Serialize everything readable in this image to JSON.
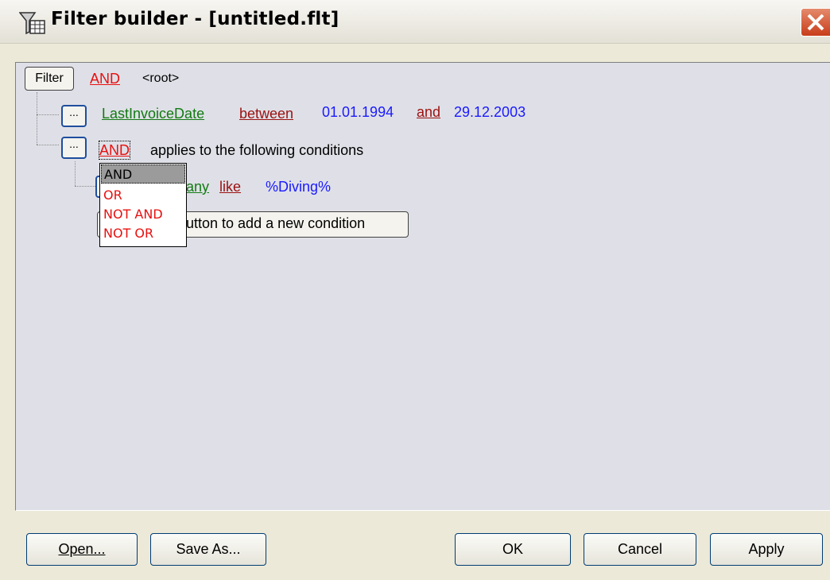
{
  "window": {
    "title": "Filter builder - [untitled.flt]"
  },
  "tree": {
    "root_button_label": "Filter",
    "root_operator": "AND",
    "root_label": "<root>",
    "condition1": {
      "button_label": "...",
      "field": "LastInvoiceDate",
      "operator": "between",
      "value1": "01.01.1994",
      "conjunction": "and",
      "value2": "29.12.2003"
    },
    "group": {
      "button_label": "...",
      "operator": "AND",
      "description": "applies to the following conditions",
      "condition": {
        "field_visible": "any",
        "operator": "like",
        "value": "%Diving%"
      },
      "add_hint_visible": "utton to add a new condition"
    }
  },
  "operator_dropdown": {
    "options": [
      "AND",
      "OR",
      "NOT AND",
      "NOT OR"
    ],
    "selected": "AND"
  },
  "buttons": {
    "open": "Open...",
    "save_as": "Save As...",
    "ok": "OK",
    "cancel": "Cancel",
    "apply": "Apply"
  },
  "colors": {
    "operator": "#e81010",
    "field": "#127a12",
    "comparison": "#9b1010",
    "value": "#1a1aff"
  }
}
